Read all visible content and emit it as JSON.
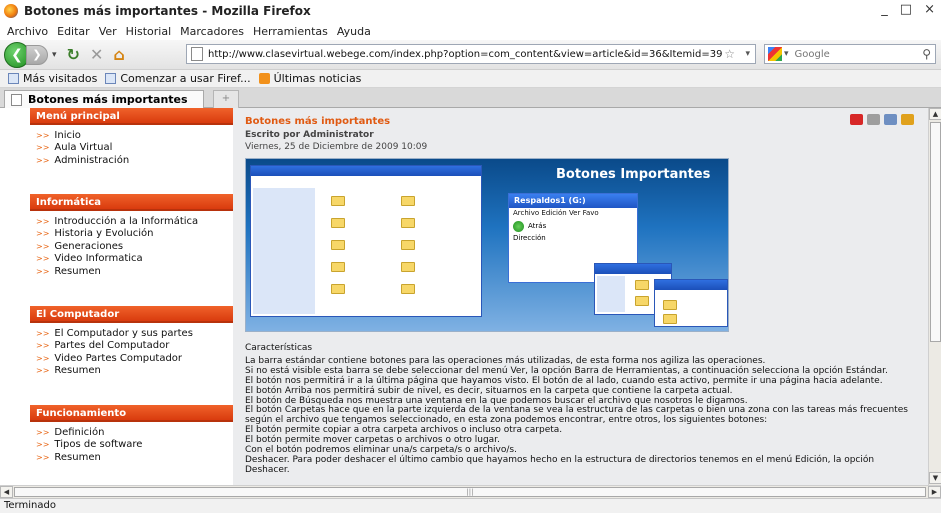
{
  "window": {
    "title": "Botones más importantes - Mozilla Firefox",
    "controls": [
      "_",
      "□",
      "×"
    ]
  },
  "menubar": [
    "Archivo",
    "Editar",
    "Ver",
    "Historial",
    "Marcadores",
    "Herramientas",
    "Ayuda"
  ],
  "navbar": {
    "url": "http://www.clasevirtual.webege.com/index.php?option=com_content&view=article&id=36&Itemid=39",
    "search_placeholder": "Google"
  },
  "bookmarks": [
    "Más visitados",
    "Comenzar a usar Firef...",
    "Últimas noticias"
  ],
  "tab": {
    "label": "Botones más importantes",
    "newtab": "+"
  },
  "sidebar": {
    "sections": [
      {
        "title": "Menú principal",
        "items": [
          "Inicio",
          "Aula Virtual",
          "Administración"
        ]
      },
      {
        "title": "Informática",
        "items": [
          "Introducción a la Informática",
          "Historia y Evolución",
          "Generaciones",
          "Video Informatica",
          "Resumen"
        ]
      },
      {
        "title": "El Computador",
        "items": [
          "El Computador y sus partes",
          "Partes del Computador",
          "Video Partes Computador",
          "Resumen"
        ]
      },
      {
        "title": "Funcionamiento",
        "items": [
          "Definición",
          "Tipos de software",
          "Resumen"
        ]
      }
    ]
  },
  "article": {
    "title": "Botones más importantes",
    "author": "Escrito por Administrator",
    "date": "Viernes, 25 de Diciembre de 2009 10:09",
    "hero": {
      "title": "Botones Importantes",
      "window_title": "Respaldos1 (G:)",
      "window_menu": "Archivo  Edición  Ver  Favo",
      "window_back": "Atrás",
      "window_address": "Dirección"
    },
    "heading": "Características",
    "paragraphs": [
      "La barra estándar contiene botones para las operaciones más utilizadas, de esta forma nos agiliza las operaciones.",
      "Si no está visible esta barra se debe seleccionar del menú Ver, la opción Barra de Herramientas, a continuación selecciona la opción Estándar.",
      "El botón  nos permitirá ir a la última página que hayamos visto. El botón de al lado, cuando esta activo, permite ir una página hacia adelante.",
      "El botón Arriba  nos permitirá subir de nivel, es decir, situarnos en la carpeta que contiene la carpeta actual.",
      "El botón de Búsqueda  nos muestra una ventana en la que podemos buscar el archivo que nosotros le digamos.",
      "El botón Carpetas  hace que en la parte izquierda de la ventana se vea la estructura de las carpetas o bien una zona con las tareas más frecuentes según el archivo que tengamos seleccionado, en esta zona podemos encontrar, entre otros, los siguientes botones:",
      "El botón  permite copiar a otra carpeta archivos o incluso otra carpeta.",
      "El botón  permite mover carpetas o archivos o otro lugar.",
      "Con el botón  podremos eliminar una/s carpeta/s o archivo/s.",
      "Deshacer. Para poder deshacer el último cambio que hayamos hecho en la estructura de directorios tenemos en el menú Edición, la opción Deshacer."
    ]
  },
  "status": "Terminado"
}
